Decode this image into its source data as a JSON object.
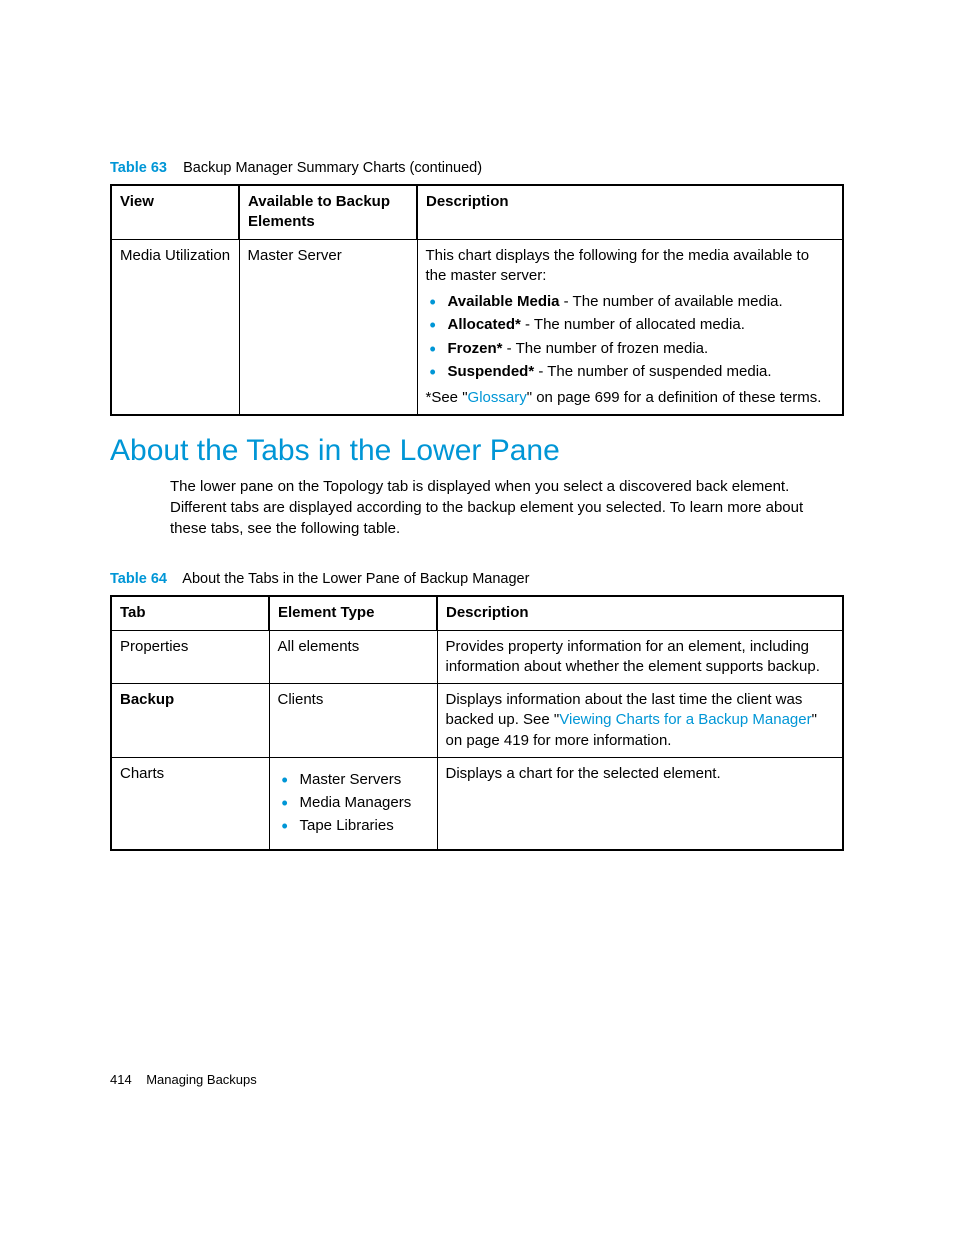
{
  "table63": {
    "label": "Table 63",
    "caption": "Backup Manager Summary Charts (continued)",
    "headers": {
      "c1": "View",
      "c2": "Available to Backup Elements",
      "c3": "Description"
    },
    "row": {
      "view": "Media Utilization",
      "elements": "Master Server",
      "desc_intro": "This chart displays the following for the media available to the master server:",
      "items": [
        {
          "term": "Available Media",
          "text": " - The number of available media."
        },
        {
          "term": "Allocated*",
          "text": " - The number of allocated media."
        },
        {
          "term": "Frozen*",
          "text": " - The number of frozen media."
        },
        {
          "term": "Suspended*",
          "text": " - The number of suspended media."
        }
      ],
      "note_pre": "*See \"",
      "note_link": "Glossary",
      "note_post": "\" on page 699 for a definition of these terms."
    }
  },
  "section_heading": "About the Tabs in the Lower Pane",
  "section_para": "The lower pane on the Topology tab is displayed when you select a discovered back element. Different tabs are displayed according to the backup element you selected. To learn more about these tabs, see the following table.",
  "table64": {
    "label": "Table 64",
    "caption": "About the Tabs in the Lower Pane of Backup Manager",
    "headers": {
      "c1": "Tab",
      "c2": "Element Type",
      "c3": "Description"
    },
    "rows": [
      {
        "tab": "Properties",
        "tab_bold": false,
        "etype_text": "All elements",
        "etype_list": null,
        "desc_pre": "Provides property information for an element, including information about whether the element supports backup.",
        "desc_link": null,
        "desc_post": null
      },
      {
        "tab": "Backup",
        "tab_bold": true,
        "etype_text": "Clients",
        "etype_list": null,
        "desc_pre": "Displays information about the last time the client was backed up. See \"",
        "desc_link": "Viewing Charts for a Backup Manager",
        "desc_post": "\" on page 419 for more information."
      },
      {
        "tab": "Charts",
        "tab_bold": false,
        "etype_text": null,
        "etype_list": [
          "Master Servers",
          "Media Managers",
          "Tape Libraries"
        ],
        "desc_pre": "Displays a chart for the selected element.",
        "desc_link": null,
        "desc_post": null
      }
    ]
  },
  "footer": {
    "page": "414",
    "title": "Managing Backups"
  }
}
